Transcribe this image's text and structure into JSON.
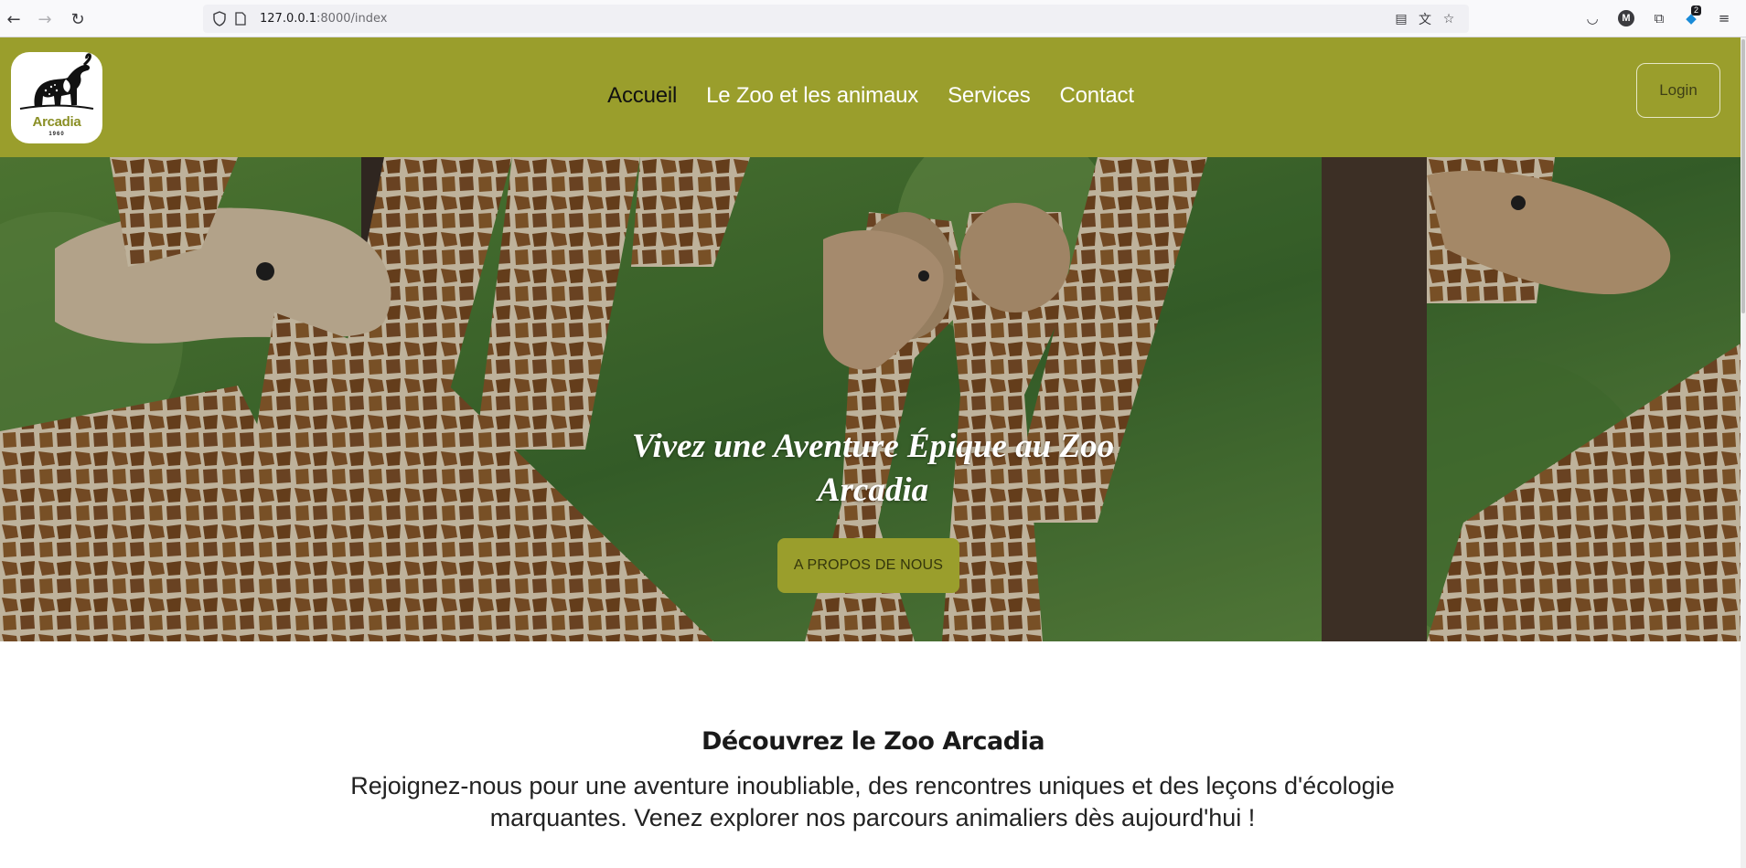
{
  "browser": {
    "url_host": "127.0.0.1",
    "url_path": ":8000/index",
    "notification_count": "2",
    "profile_initial": "M"
  },
  "header": {
    "logo_brand": "Arcadia",
    "logo_year": "1960",
    "nav": [
      {
        "label": "Accueil",
        "active": true
      },
      {
        "label": "Le Zoo et les animaux",
        "active": false
      },
      {
        "label": "Services",
        "active": false
      },
      {
        "label": "Contact",
        "active": false
      }
    ],
    "login_label": "Login",
    "bg_color": "#9a9e2c"
  },
  "hero": {
    "title_line1": "Vivez une Aventure Épique au Zoo",
    "title_line2": "Arcadia",
    "button_label": "A PROPOS DE NOUS",
    "image_subject": "giraffes"
  },
  "intro": {
    "heading": "Découvrez le Zoo Arcadia",
    "text_line1": "Rejoignez-nous pour une aventure inoubliable, des rencontres uniques et des leçons d'écologie",
    "text_line2": "marquantes. Venez explorer nos parcours animaliers dès aujourd'hui !"
  }
}
